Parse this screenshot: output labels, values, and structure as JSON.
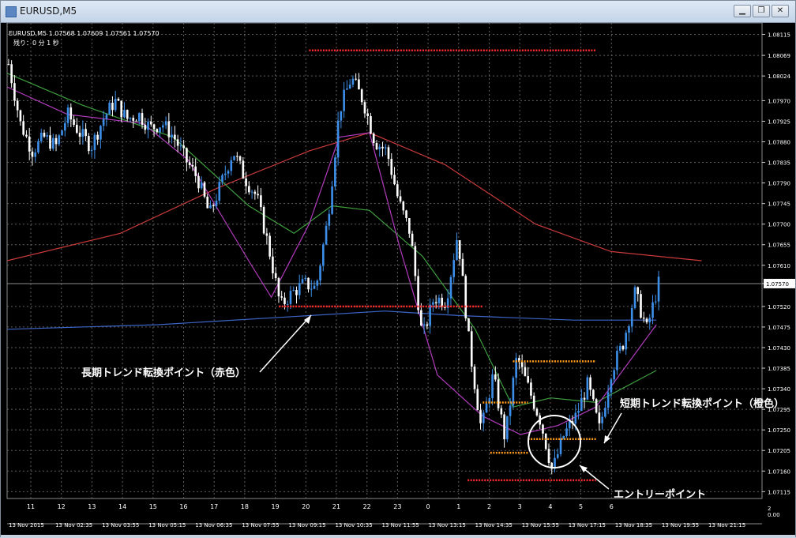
{
  "window": {
    "title": "EURUSD,M5",
    "buttons": [
      "minimize",
      "restore",
      "close"
    ]
  },
  "chart_header": {
    "symbol_line": "EURUSD,M5  1.07568 1.07609 1.07561 1.07570",
    "countdown": "残り：0 分 1 秒"
  },
  "annotations": {
    "long_term": "長期トレンド転換ポイント（赤色）",
    "short_term": "短期トレンド転換ポイント（橙色）",
    "entry": "エントリーポイント"
  },
  "colors": {
    "background": "#000000",
    "grid": "#5f5f5f",
    "axis_text": "#ffffff",
    "bull_candle": "#3d8ee8",
    "bear_candle": "#ffffff",
    "ma_red": "#c93a3a",
    "ma_green": "#3f9f3f",
    "ma_magenta": "#b23bbd",
    "ma_blue": "#3d65c8",
    "red_level": "#ff2a2a",
    "orange_level": "#ff9a1a",
    "current_price": "#8c8c8c"
  },
  "chart_data": {
    "type": "candlestick",
    "symbol": "EURUSD",
    "timeframe": "M5",
    "ohlc_header": {
      "open": 1.07568,
      "high": 1.07609,
      "low": 1.07561,
      "close": 1.0757
    },
    "current_price_label": "1.07570",
    "y_ticks": [
      "1.08115",
      "1.08069",
      "1.08024",
      "1.07970",
      "1.07925",
      "1.07880",
      "1.07835",
      "1.07790",
      "1.07745",
      "1.07700",
      "1.07655",
      "1.07610",
      "1.07570",
      "1.07520",
      "1.07475",
      "1.07430",
      "1.07385",
      "1.07340",
      "1.07295",
      "1.07250",
      "1.07205",
      "1.07160",
      "1.07115"
    ],
    "ylim": [
      1.071,
      1.0814
    ],
    "x_ticks_top": [
      "11",
      "12",
      "13",
      "14",
      "15",
      "16",
      "17",
      "18",
      "19",
      "20",
      "21",
      "22",
      "23",
      "0",
      "1",
      "2",
      "3",
      "4",
      "5",
      "6"
    ],
    "x_ticks_bottom": [
      "13 Nov 2015",
      "13 Nov 02:35",
      "13 Nov 03:55",
      "13 Nov 05:15",
      "13 Nov 06:35",
      "13 Nov 07:55",
      "13 Nov 09:15",
      "13 Nov 10:35",
      "13 Nov 11:55",
      "13 Nov 13:15",
      "13 Nov 14:35",
      "13 Nov 15:55",
      "13 Nov 17:15",
      "13 Nov 18:35",
      "13 Nov 19:55",
      "13 Nov 21:15"
    ],
    "indicator_panel_labels": [
      "2",
      "0.00"
    ],
    "price_path": [
      1.0805,
      1.0792,
      1.0786,
      1.0789,
      1.0787,
      1.0794,
      1.079,
      1.0787,
      1.0793,
      1.0797,
      1.0793,
      1.0794,
      1.0791,
      1.0792,
      1.0789,
      1.0784,
      1.078,
      1.0772,
      1.0779,
      1.0786,
      1.078,
      1.0776,
      1.0765,
      1.0752,
      1.0755,
      1.0757,
      1.0756,
      1.0771,
      1.0795,
      1.0802,
      1.0797,
      1.0788,
      1.0786,
      1.0775,
      1.0768,
      1.0745,
      1.0754,
      1.0753,
      1.0768,
      1.0743,
      1.0725,
      1.0737,
      1.0723,
      1.0741,
      1.0734,
      1.0727,
      1.0716,
      1.0724,
      1.0728,
      1.0735,
      1.0725,
      1.0738,
      1.0744,
      1.0755,
      1.0747,
      1.0757
    ],
    "moving_averages": [
      {
        "color": "red",
        "points": [
          [
            0,
            1.0762
          ],
          [
            0.15,
            1.0768
          ],
          [
            0.28,
            1.0778
          ],
          [
            0.4,
            1.0786
          ],
          [
            0.48,
            1.079
          ],
          [
            0.58,
            1.0783
          ],
          [
            0.7,
            1.077
          ],
          [
            0.8,
            1.0764
          ],
          [
            0.92,
            1.0762
          ]
        ]
      },
      {
        "color": "green",
        "points": [
          [
            0,
            1.0803
          ],
          [
            0.1,
            1.0796
          ],
          [
            0.22,
            1.0789
          ],
          [
            0.32,
            1.0774
          ],
          [
            0.38,
            1.0768
          ],
          [
            0.43,
            1.0774
          ],
          [
            0.48,
            1.0773
          ],
          [
            0.55,
            1.0763
          ],
          [
            0.62,
            1.0747
          ],
          [
            0.67,
            1.073
          ],
          [
            0.72,
            1.0732
          ],
          [
            0.78,
            1.0731
          ],
          [
            0.86,
            1.0738
          ]
        ]
      },
      {
        "color": "magenta",
        "points": [
          [
            0,
            1.08
          ],
          [
            0.08,
            1.0794
          ],
          [
            0.18,
            1.0792
          ],
          [
            0.24,
            1.0784
          ],
          [
            0.32,
            1.0762
          ],
          [
            0.35,
            1.0754
          ],
          [
            0.4,
            1.077
          ],
          [
            0.44,
            1.0789
          ],
          [
            0.48,
            1.079
          ],
          [
            0.52,
            1.0765
          ],
          [
            0.57,
            1.0737
          ],
          [
            0.63,
            1.0728
          ],
          [
            0.68,
            1.0724
          ],
          [
            0.73,
            1.0726
          ],
          [
            0.78,
            1.073
          ],
          [
            0.86,
            1.0748
          ]
        ]
      },
      {
        "color": "blue",
        "points": [
          [
            0,
            1.0747
          ],
          [
            0.2,
            1.0748
          ],
          [
            0.4,
            1.075
          ],
          [
            0.5,
            1.0751
          ],
          [
            0.6,
            1.075
          ],
          [
            0.75,
            1.0749
          ],
          [
            0.86,
            1.0749
          ]
        ]
      }
    ],
    "levels": [
      {
        "color": "red",
        "price": 1.0808,
        "x_from": 0.4,
        "x_to": 0.78
      },
      {
        "color": "red",
        "price": 1.0752,
        "x_from": 0.36,
        "x_to": 0.63
      },
      {
        "color": "red",
        "price": 1.0714,
        "x_from": 0.61,
        "x_to": 0.78
      },
      {
        "color": "orange",
        "price": 1.074,
        "x_from": 0.67,
        "x_to": 0.78
      },
      {
        "color": "orange",
        "price": 1.0731,
        "x_from": 0.63,
        "x_to": 0.69
      },
      {
        "color": "orange",
        "price": 1.0723,
        "x_from": 0.69,
        "x_to": 0.78
      },
      {
        "color": "orange",
        "price": 1.072,
        "x_from": 0.64,
        "x_to": 0.69
      }
    ]
  }
}
